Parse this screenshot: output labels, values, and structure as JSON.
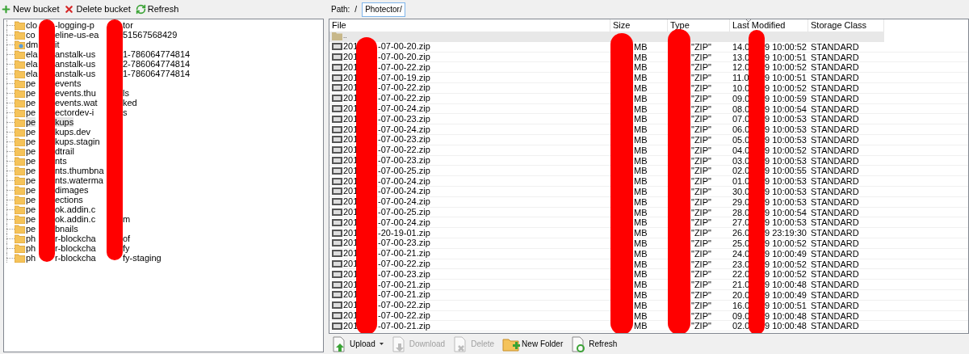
{
  "toolbar": [
    {
      "label": "New bucket",
      "kind": "add"
    },
    {
      "label": "Delete bucket",
      "kind": "delete"
    },
    {
      "label": "Refresh",
      "kind": "refresh"
    }
  ],
  "buckets": [
    {
      "parts": [
        "clo",
        "-logging-p",
        "tor"
      ],
      "kind": "folder",
      "selected": false
    },
    {
      "parts": [
        "co",
        "eline-us-ea",
        "51567568429"
      ],
      "kind": "folder",
      "selected": false
    },
    {
      "parts": [
        "dm",
        "it"
      ],
      "kind": "shared",
      "selected": false
    },
    {
      "parts": [
        "ela",
        "anstalk-us",
        "1-786064774814"
      ],
      "kind": "folder",
      "selected": false
    },
    {
      "parts": [
        "ela",
        "anstalk-us",
        "2-786064774814"
      ],
      "kind": "folder",
      "selected": false
    },
    {
      "parts": [
        "ela",
        "anstalk-us",
        "1-786064774814"
      ],
      "kind": "folder",
      "selected": false
    },
    {
      "parts": [
        "pe",
        "events"
      ],
      "kind": "folder",
      "selected": false
    },
    {
      "parts": [
        "pe",
        "events.thu",
        "ls"
      ],
      "kind": "folder",
      "selected": false
    },
    {
      "parts": [
        "pe",
        "events.wat",
        "ked"
      ],
      "kind": "folder",
      "selected": false
    },
    {
      "parts": [
        "pe",
        "ectordev-i",
        "s"
      ],
      "kind": "folder",
      "selected": false
    },
    {
      "parts": [
        "pe",
        "kups"
      ],
      "kind": "folder",
      "selected": true
    },
    {
      "parts": [
        "pe",
        "kups.dev"
      ],
      "kind": "folder",
      "selected": false
    },
    {
      "parts": [
        "pe",
        "kups.stagin"
      ],
      "kind": "folder",
      "selected": false
    },
    {
      "parts": [
        "pe",
        "dtrail"
      ],
      "kind": "folder",
      "selected": false
    },
    {
      "parts": [
        "pe",
        "nts"
      ],
      "kind": "folder",
      "selected": false
    },
    {
      "parts": [
        "pe",
        "nts.thumbna"
      ],
      "kind": "folder",
      "selected": false
    },
    {
      "parts": [
        "pe",
        "nts.waterma"
      ],
      "kind": "folder",
      "selected": false
    },
    {
      "parts": [
        "pe",
        "dimages"
      ],
      "kind": "folder",
      "selected": false
    },
    {
      "parts": [
        "pe",
        "ections"
      ],
      "kind": "folder",
      "selected": false
    },
    {
      "parts": [
        "pe",
        "ok.addin.c"
      ],
      "kind": "folder",
      "selected": false
    },
    {
      "parts": [
        "pe",
        "ok.addin.c",
        "m"
      ],
      "kind": "folder",
      "selected": false
    },
    {
      "parts": [
        "pe",
        "bnails"
      ],
      "kind": "folder",
      "selected": false
    },
    {
      "parts": [
        "ph",
        "r-blockcha",
        "of"
      ],
      "kind": "folder",
      "selected": false
    },
    {
      "parts": [
        "ph",
        "r-blockcha",
        "fy"
      ],
      "kind": "folder",
      "selected": false
    },
    {
      "parts": [
        "ph",
        "r-blockcha",
        "fy-staging"
      ],
      "kind": "folder",
      "selected": false
    }
  ],
  "path": {
    "label": "Path:",
    "separator": "/",
    "value": "Photector/"
  },
  "columns": [
    {
      "label": "File",
      "sorted": false
    },
    {
      "label": "Size",
      "sorted": false
    },
    {
      "label": "Type",
      "sorted": false
    },
    {
      "label": "Last Modified",
      "sorted": true
    },
    {
      "label": "Storage Class",
      "sorted": false
    }
  ],
  "parent_row": {
    "label": "..",
    "selected": true
  },
  "files": [
    {
      "name": [
        "201",
        "-07-00-20.zip"
      ],
      "size": "MB",
      "type": "\"ZIP\"",
      "modified": [
        "14.0",
        "9 10:00:52"
      ],
      "storage": "STANDARD",
      "selected": false
    },
    {
      "name": [
        "201",
        "-07-00-20.zip"
      ],
      "size": "MB",
      "type": "\"ZIP\"",
      "modified": [
        "13.0",
        "9 10:00:51"
      ],
      "storage": "STANDARD",
      "selected": false
    },
    {
      "name": [
        "201",
        "-07-00-22.zip"
      ],
      "size": "MB",
      "type": "\"ZIP\"",
      "modified": [
        "12.0",
        "9 10:00:52"
      ],
      "storage": "STANDARD",
      "selected": false
    },
    {
      "name": [
        "201",
        "-07-00-19.zip"
      ],
      "size": "MB",
      "type": "\"ZIP\"",
      "modified": [
        "11.0",
        "9 10:00:51"
      ],
      "storage": "STANDARD",
      "selected": false
    },
    {
      "name": [
        "201",
        "-07-00-22.zip"
      ],
      "size": "MB",
      "type": "\"ZIP\"",
      "modified": [
        "10.0",
        "9 10:00:52"
      ],
      "storage": "STANDARD",
      "selected": false
    },
    {
      "name": [
        "201",
        "-07-00-22.zip"
      ],
      "size": "MB",
      "type": "\"ZIP\"",
      "modified": [
        "09.0",
        "9 10:00:59"
      ],
      "storage": "STANDARD",
      "selected": false
    },
    {
      "name": [
        "201",
        "-07-00-24.zip"
      ],
      "size": "MB",
      "type": "\"ZIP\"",
      "modified": [
        "08.0",
        "9 10:00:54"
      ],
      "storage": "STANDARD",
      "selected": false
    },
    {
      "name": [
        "201",
        "-07-00-23.zip"
      ],
      "size": "MB",
      "type": "\"ZIP\"",
      "modified": [
        "07.0",
        "9 10:00:53"
      ],
      "storage": "STANDARD",
      "selected": false
    },
    {
      "name": [
        "201",
        "-07-00-24.zip"
      ],
      "size": "MB",
      "type": "\"ZIP\"",
      "modified": [
        "06.0",
        "9 10:00:53"
      ],
      "storage": "STANDARD",
      "selected": false
    },
    {
      "name": [
        "201",
        "-07-00-23.zip"
      ],
      "size": "MB",
      "type": "\"ZIP\"",
      "modified": [
        "05.0",
        "9 10:00:53"
      ],
      "storage": "STANDARD",
      "selected": false
    },
    {
      "name": [
        "201",
        "-07-00-22.zip"
      ],
      "size": "MB",
      "type": "\"ZIP\"",
      "modified": [
        "04.0",
        "9 10:00:52"
      ],
      "storage": "STANDARD",
      "selected": false
    },
    {
      "name": [
        "201",
        "-07-00-23.zip"
      ],
      "size": "MB",
      "type": "\"ZIP\"",
      "modified": [
        "03.0",
        "9 10:00:53"
      ],
      "storage": "STANDARD",
      "selected": false
    },
    {
      "name": [
        "201",
        "-07-00-25.zip"
      ],
      "size": "MB",
      "type": "\"ZIP\"",
      "modified": [
        "02.0",
        "9 10:00:55"
      ],
      "storage": "STANDARD",
      "selected": false
    },
    {
      "name": [
        "201",
        "-07-00-24.zip"
      ],
      "size": "MB",
      "type": "\"ZIP\"",
      "modified": [
        "01.0",
        "9 10:00:53"
      ],
      "storage": "STANDARD",
      "selected": false
    },
    {
      "name": [
        "201",
        "-07-00-24.zip"
      ],
      "size": "MB",
      "type": "\"ZIP\"",
      "modified": [
        "30.0",
        "9 10:00:53"
      ],
      "storage": "STANDARD",
      "selected": false
    },
    {
      "name": [
        "201",
        "-07-00-24.zip"
      ],
      "size": "MB",
      "type": "\"ZIP\"",
      "modified": [
        "29.0",
        "9 10:00:53"
      ],
      "storage": "STANDARD",
      "selected": false
    },
    {
      "name": [
        "201",
        "-07-00-25.zip"
      ],
      "size": "MB",
      "type": "\"ZIP\"",
      "modified": [
        "28.0",
        "9 10:00:54"
      ],
      "storage": "STANDARD",
      "selected": false
    },
    {
      "name": [
        "201",
        "-07-00-24.zip"
      ],
      "size": "MB",
      "type": "\"ZIP\"",
      "modified": [
        "27.0",
        "9 10:00:53"
      ],
      "storage": "STANDARD",
      "selected": false
    },
    {
      "name": [
        "201",
        "-20-19-01.zip"
      ],
      "size": "MB",
      "type": "\"ZIP\"",
      "modified": [
        "26.0",
        "9 23:19:30"
      ],
      "storage": "STANDARD",
      "selected": false
    },
    {
      "name": [
        "201",
        "-07-00-23.zip"
      ],
      "size": "MB",
      "type": "\"ZIP\"",
      "modified": [
        "25.0",
        "9 10:00:52"
      ],
      "storage": "STANDARD",
      "selected": false
    },
    {
      "name": [
        "201",
        "-07-00-21.zip"
      ],
      "size": "MB",
      "type": "\"ZIP\"",
      "modified": [
        "24.0",
        "9 10:00:49"
      ],
      "storage": "STANDARD",
      "selected": false
    },
    {
      "name": [
        "201",
        "-07-00-22.zip"
      ],
      "size": "MB",
      "type": "\"ZIP\"",
      "modified": [
        "23.0",
        "9 10:00:52"
      ],
      "storage": "STANDARD",
      "selected": false
    },
    {
      "name": [
        "201",
        "-07-00-23.zip"
      ],
      "size": "MB",
      "type": "\"ZIP\"",
      "modified": [
        "22.0",
        "9 10:00:52"
      ],
      "storage": "STANDARD",
      "selected": false
    },
    {
      "name": [
        "201",
        "-07-00-21.zip"
      ],
      "size": "MB",
      "type": "\"ZIP\"",
      "modified": [
        "21.0",
        "9 10:00:48"
      ],
      "storage": "STANDARD",
      "selected": false
    },
    {
      "name": [
        "201",
        "-07-00-21.zip"
      ],
      "size": "MB",
      "type": "\"ZIP\"",
      "modified": [
        "20.0",
        "9 10:00:49"
      ],
      "storage": "STANDARD",
      "selected": false
    },
    {
      "name": [
        "201",
        "-07-00-22.zip"
      ],
      "size": "MB",
      "type": "\"ZIP\"",
      "modified": [
        "16.0",
        "9 10:00:51"
      ],
      "storage": "STANDARD",
      "selected": false
    },
    {
      "name": [
        "201",
        "-07-00-22.zip"
      ],
      "size": "MB",
      "type": "\"ZIP\"",
      "modified": [
        "09.0",
        "9 10:00:48"
      ],
      "storage": "STANDARD",
      "selected": false
    },
    {
      "name": [
        "201",
        "-07-00-21.zip"
      ],
      "size": "MB",
      "type": "\"ZIP\"",
      "modified": [
        "02.0",
        "9 10:00:48"
      ],
      "storage": "STANDARD",
      "selected": false
    }
  ],
  "bottom_toolbar": [
    {
      "label": "Upload",
      "kind": "upload",
      "disabled": false,
      "dropdown": true
    },
    {
      "label": "Download",
      "kind": "download",
      "disabled": true,
      "dropdown": false
    },
    {
      "label": "Delete",
      "kind": "delete",
      "disabled": true,
      "dropdown": false
    },
    {
      "label": "New Folder",
      "kind": "folder",
      "disabled": false,
      "dropdown": false
    },
    {
      "label": "Refresh",
      "kind": "refresh",
      "disabled": false,
      "dropdown": false
    }
  ]
}
